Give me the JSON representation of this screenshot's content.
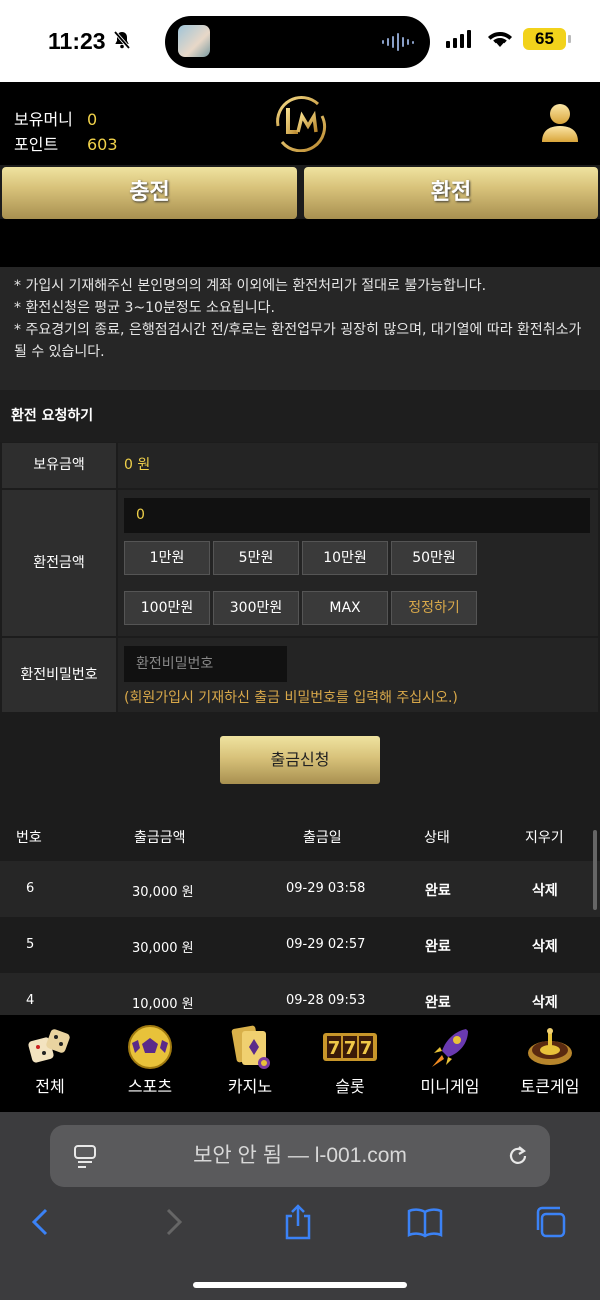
{
  "status": {
    "time": "11:23",
    "battery": "65"
  },
  "header": {
    "money_label": "보유머니",
    "money_value": "0",
    "points_label": "포인트",
    "points_value": "603"
  },
  "actions": {
    "charge": "충전",
    "exchange": "환전"
  },
  "notice": [
    "* 가입시 기재해주신 본인명의의 계좌 이외에는 환전처리가 절대로 불가능합니다.",
    "* 환전신청은 평균 3~10분정도 소요됩니다.",
    "* 주요경기의 종료, 은행점검시간 전/후로는 환전업무가 굉장히 많으며, 대기열에 따라 환전취소가 될 수 있습니다."
  ],
  "form": {
    "title": "환전 요청하기",
    "balance_label": "보유금액",
    "balance_value": "0 원",
    "amount_label": "환전금액",
    "amount_value": "0",
    "quick_buttons": [
      "1만원",
      "5만원",
      "10만원",
      "50만원",
      "100만원",
      "300만원",
      "MAX",
      "정정하기"
    ],
    "password_label": "환전비밀번호",
    "password_placeholder": "환전비밀번호",
    "password_hint": "(회원가입시 기재하신 출금 비밀번호를 입력해 주십시오.)",
    "submit": "출금신청"
  },
  "history": {
    "headers": [
      "번호",
      "출금금액",
      "출금일",
      "상태",
      "지우기"
    ],
    "rows": [
      {
        "no": "6",
        "amount": "30,000 원",
        "date": "09-29 03:58",
        "status": "완료",
        "delete": "삭제"
      },
      {
        "no": "5",
        "amount": "30,000 원",
        "date": "09-29 02:57",
        "status": "완료",
        "delete": "삭제"
      },
      {
        "no": "4",
        "amount": "10,000 원",
        "date": "09-28 09:53",
        "status": "완료",
        "delete": "삭제"
      }
    ]
  },
  "nav": [
    {
      "label": "전체",
      "icon": "dice-icon"
    },
    {
      "label": "스포츠",
      "icon": "soccer-ball-icon"
    },
    {
      "label": "카지노",
      "icon": "cards-icon"
    },
    {
      "label": "슬롯",
      "icon": "slot-777-icon"
    },
    {
      "label": "미니게임",
      "icon": "rocket-icon"
    },
    {
      "label": "토큰게임",
      "icon": "roulette-icon"
    }
  ],
  "browser": {
    "url_text": "보안 안 됨 — l-001.com"
  },
  "colors": {
    "gold": "#f0d14a",
    "hint": "#d8a84a",
    "panel": "#262626"
  }
}
